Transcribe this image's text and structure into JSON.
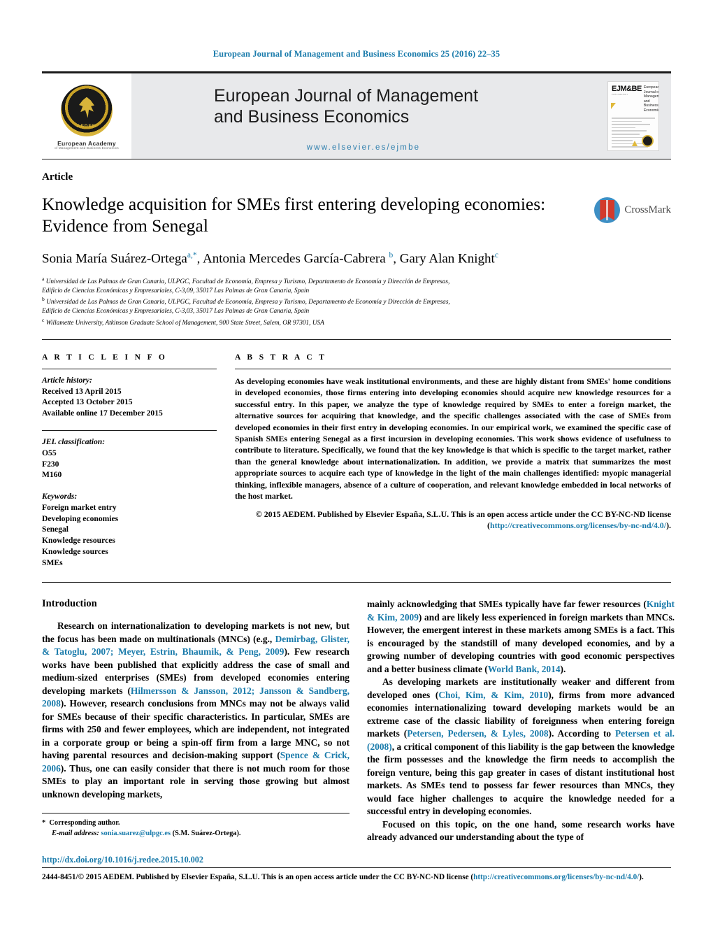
{
  "running_head": "European Journal of Management and Business Economics 25 (2016) 22–35",
  "masthead": {
    "journal_title_line1": "European Journal of Management",
    "journal_title_line2": "and Business Economics",
    "elsevier_url": "www.elsevier.es/ejmbe",
    "logo": {
      "seal_word": "AEDEM",
      "caption_line1": "European Academy",
      "caption_line2": "of Management and Business Economics"
    },
    "cover": {
      "mark": "EJM&BE",
      "mark_sub": "ISSN 2444-8451",
      "title": "European Journal of Management and Business Economics"
    }
  },
  "article": {
    "kind": "Article",
    "title_line1": "Knowledge acquisition for SMEs first entering developing economies:",
    "title_line2": "Evidence from Senegal",
    "crossmark_label": "CrossMark",
    "authors": [
      {
        "name": "Sonia María Suárez-Ortega",
        "marks": "a,*"
      },
      {
        "name": "Antonia Mercedes García-Cabrera",
        "marks": "b"
      },
      {
        "name": "Gary Alan Knight",
        "marks": "c"
      }
    ],
    "affiliations": [
      {
        "mark": "a",
        "line1": "Universidad de Las Palmas de Gran Canaria, ULPGC, Facultad de Economía, Empresa y Turismo, Departamento de Economía y Dirección de Empresas,",
        "line2": "Edificio de Ciencias Económicas y Empresariales, C-3,09, 35017 Las Palmas de Gran Canaria, Spain"
      },
      {
        "mark": "b",
        "line1": "Universidad de Las Palmas de Gran Canaria, ULPGC, Facultad de Economía, Empresa y Turismo, Departamento de Economía y Dirección de Empresas,",
        "line2": "Edificio de Ciencias Económicas y Empresariales, C-3,03, 35017 Las Palmas de Gran Canaria, Spain"
      },
      {
        "mark": "c",
        "line1": "Willamette University, Atkinson Graduate School of Management, 900 State Street, Salem, OR 97301, USA",
        "line2": ""
      }
    ]
  },
  "article_info": {
    "heading": "A R T I C L E   I N F O",
    "history_label": "Article history:",
    "history": [
      "Received 13 April 2015",
      "Accepted 13 October 2015",
      "Available online 17 December 2015"
    ],
    "jel_label": "JEL classification:",
    "jel": [
      "O55",
      "F230",
      "M160"
    ],
    "keywords_label": "Keywords:",
    "keywords": [
      "Foreign market entry",
      "Developing economies",
      "Senegal",
      "Knowledge resources",
      "Knowledge sources",
      "SMEs"
    ]
  },
  "abstract": {
    "heading": "A B S T R A C T",
    "text": "As developing economies have weak institutional environments, and these are highly distant from SMEs' home conditions in developed economies, those firms entering into developing economies should acquire new knowledge resources for a successful entry. In this paper, we analyze the type of knowledge required by SMEs to enter a foreign market, the alternative sources for acquiring that knowledge, and the specific challenges associated with the case of SMEs from developed economies in their first entry in developing economies. In our empirical work, we examined the specific case of Spanish SMEs entering Senegal as a first incursion in developing economies. This work shows evidence of usefulness to contribute to literature. Specifically, we found that the key knowledge is that which is specific to the target market, rather than the general knowledge about internationalization. In addition, we provide a matrix that summarizes the most appropriate sources to acquire each type of knowledge in the light of the main challenges identified: myopic managerial thinking, inflexible managers, absence of a culture of cooperation, and relevant knowledge embedded in local networks of the host market.",
    "copyright_pre": "© 2015 AEDEM. Published by Elsevier España, S.L.U. This is an open access article under the CC BY-NC-ND license (",
    "copyright_link": "http://creativecommons.org/licenses/by-nc-nd/4.0/",
    "copyright_post": ")."
  },
  "body": {
    "intro_heading": "Introduction",
    "left_para1_a": "Research on internationalization to developing markets is not new, but the focus has been made on multinationals (MNCs) (e.g., ",
    "left_para1_cite1": "Demirbag, Glister, & Tatoglu, 2007; Meyer, Estrin, Bhaumik, & Peng, 2009",
    "left_para1_b": "). Few research works have been published that explicitly address the case of small and medium-sized enterprises (SMEs) from developed economies entering developing markets (",
    "left_para1_cite2": "Hilmersson & Jansson, 2012; Jansson & Sandberg, 2008",
    "left_para1_c": "). However, research conclusions from MNCs may not be always valid for SMEs because of their specific characteristics. In particular, SMEs are firms with 250 and fewer employees, which are independent, not integrated in a corporate group or being a spin-off firm from a large MNC, so not having parental resources and decision-making support (",
    "left_para1_cite3": "Spence & Crick, 2006",
    "left_para1_d": "). Thus, one can easily consider that there is not much room for those SMEs to play an important role in serving those growing but almost unknown developing markets,",
    "right_para1_a": "mainly acknowledging that SMEs typically have far fewer resources (",
    "right_para1_cite1": "Knight & Kim, 2009",
    "right_para1_b": ") and are likely less experienced in foreign markets than MNCs. However, the emergent interest in these markets among SMEs is a fact. This is encouraged by the standstill of many developed economies, and by a growing number of developing countries with good economic perspectives and a better business climate (",
    "right_para1_cite2": "World Bank, 2014",
    "right_para1_c": ").",
    "right_para2_a": "As developing markets are institutionally weaker and different from developed ones (",
    "right_para2_cite1": "Choi, Kim, & Kim, 2010",
    "right_para2_b": "), firms from more advanced economies internationalizing toward developing markets would be an extreme case of the classic liability of foreignness when entering foreign markets (",
    "right_para2_cite2": "Petersen, Pedersen, & Lyles, 2008",
    "right_para2_c": "). According to ",
    "right_para2_cite3": "Petersen et al. (2008)",
    "right_para2_d": ", a critical component of this liability is the gap between the knowledge the firm possesses and the knowledge the firm needs to accomplish the foreign venture, being this gap greater in cases of distant institutional host markets. As SMEs tend to possess far fewer resources than MNCs, they would face higher challenges to acquire the knowledge needed for a successful entry in developing economies.",
    "right_para3": "Focused on this topic, on the one hand, some research works have already advanced our understanding about the type of"
  },
  "footer": {
    "corresponding_star": "*",
    "corresponding_label": "Corresponding author.",
    "email_label": "E-mail address:",
    "email": "sonia.suarez@ulpgc.es",
    "email_owner": "(S.M. Suárez-Ortega).",
    "doi": "http://dx.doi.org/10.1016/j.redee.2015.10.002",
    "issn_pre": "2444-8451/© 2015 AEDEM. Published by Elsevier España, S.L.U. This is an open access article under the CC BY-NC-ND license (",
    "issn_link": "http://creativecommons.org/licenses/by-nc-nd/4.0/",
    "issn_post": ")."
  },
  "colors": {
    "link": "#1a7bab",
    "masthead_bg": "#e8e9eb",
    "gold": "#d8b43a"
  }
}
